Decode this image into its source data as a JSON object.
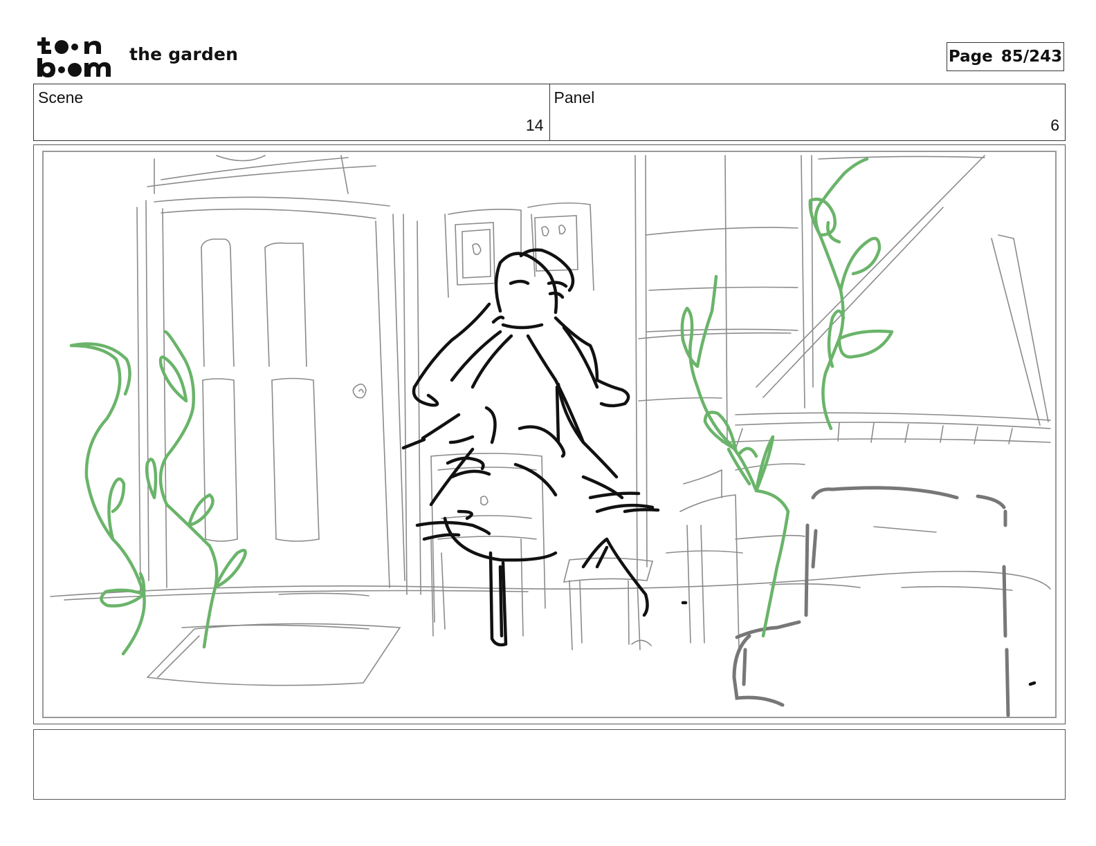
{
  "header": {
    "logo_brand": "toon boom",
    "project_title": "the garden",
    "page_label": "Page",
    "page_number": "85/243"
  },
  "info": {
    "scene_label": "Scene",
    "scene_value": "14",
    "panel_label": "Panel",
    "panel_value": "6"
  },
  "caption": {
    "text": ""
  },
  "colors": {
    "sketch_grey": "#8a8a8a",
    "figure_black": "#111111",
    "plant_green": "#6ab46a"
  }
}
